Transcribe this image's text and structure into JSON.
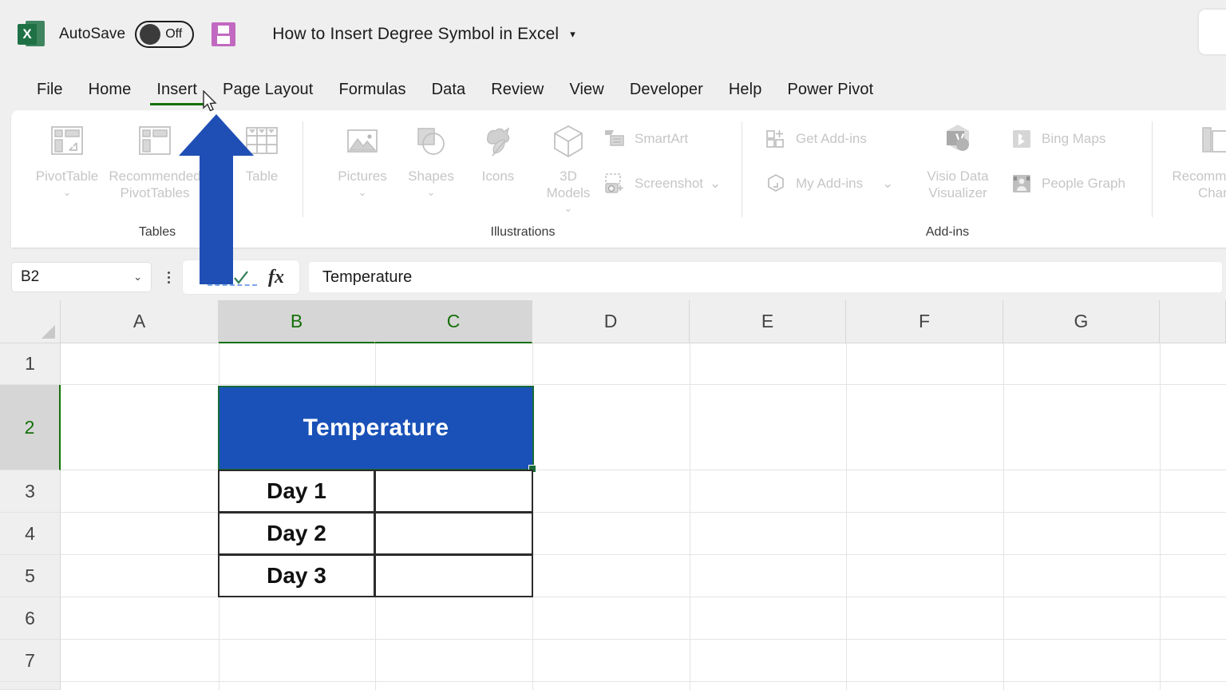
{
  "titlebar": {
    "app_icon": "excel-logo-icon",
    "autosave_label": "AutoSave",
    "autosave_state": "Off",
    "save_icon": "save-floppy-icon",
    "document_title": "How to Insert Degree Symbol in Excel",
    "title_caret": "▾"
  },
  "tabs": [
    {
      "label": "File",
      "active": false
    },
    {
      "label": "Home",
      "active": false
    },
    {
      "label": "Insert",
      "active": true
    },
    {
      "label": "Page Layout",
      "active": false
    },
    {
      "label": "Formulas",
      "active": false
    },
    {
      "label": "Data",
      "active": false
    },
    {
      "label": "Review",
      "active": false
    },
    {
      "label": "View",
      "active": false
    },
    {
      "label": "Developer",
      "active": false
    },
    {
      "label": "Help",
      "active": false
    },
    {
      "label": "Power Pivot",
      "active": false
    }
  ],
  "ribbon": {
    "groups": [
      {
        "name": "Tables",
        "title": "Tables",
        "buttons": [
          {
            "label": "PivotTable",
            "icon": "pivottable-icon",
            "has_caret": true
          },
          {
            "label": "Recommended\nPivotTables",
            "icon": "recommended-pivottables-icon",
            "has_caret": false
          },
          {
            "label": "Table",
            "icon": "table-icon",
            "has_caret": false
          }
        ]
      },
      {
        "name": "Illustrations",
        "title": "Illustrations",
        "buttons": [
          {
            "label": "Pictures",
            "icon": "pictures-icon",
            "has_caret": true
          },
          {
            "label": "Shapes",
            "icon": "shapes-icon",
            "has_caret": true
          },
          {
            "label": "Icons",
            "icon": "icons-icon",
            "has_caret": false
          },
          {
            "label": "3D\nModels",
            "icon": "3d-models-icon",
            "has_caret": true
          }
        ],
        "small_buttons": [
          {
            "label": "SmartArt",
            "icon": "smartart-icon",
            "has_caret": false
          },
          {
            "label": "Screenshot",
            "icon": "screenshot-icon",
            "has_caret": true
          }
        ]
      },
      {
        "name": "Add-ins",
        "title": "Add-ins",
        "small_buttons": [
          {
            "label": "Get Add-ins",
            "icon": "get-addins-icon",
            "has_caret": false
          },
          {
            "label": "My Add-ins",
            "icon": "my-addins-icon",
            "has_caret": true
          },
          {
            "label": "Bing Maps",
            "icon": "bing-maps-icon",
            "has_caret": false
          },
          {
            "label": "People Graph",
            "icon": "people-graph-icon",
            "has_caret": false
          }
        ],
        "buttons": [
          {
            "label": "Visio Data\nVisualizer",
            "icon": "visio-data-visualizer-icon",
            "has_caret": false
          }
        ]
      },
      {
        "name": "Charts",
        "title": "",
        "buttons": [
          {
            "label": "Recommended\nCharts",
            "icon": "recommended-charts-icon",
            "has_caret": false
          }
        ]
      }
    ]
  },
  "formula_bar": {
    "name_box_value": "B2",
    "name_box_caret": "⌄",
    "cancel_icon": "cancel-x-icon",
    "enter_icon": "enter-check-icon",
    "function_icon": "fx-icon",
    "function_label": "fx",
    "formula_value": "Temperature"
  },
  "grid": {
    "columns": [
      "A",
      "B",
      "C",
      "D",
      "E",
      "F",
      "G"
    ],
    "selected_columns": [
      "B",
      "C"
    ],
    "rows": [
      "1",
      "2",
      "3",
      "4",
      "5",
      "6",
      "7"
    ],
    "selected_rows": [
      "2"
    ],
    "active_cell": "B2",
    "merged_title": {
      "range": "B2:C2",
      "text": "Temperature",
      "fill_color": "#1A51B8",
      "font_color": "#FFFFFF"
    },
    "table_rows": [
      {
        "label": "Day 1",
        "value": ""
      },
      {
        "label": "Day 2",
        "value": ""
      },
      {
        "label": "Day 3",
        "value": ""
      }
    ]
  },
  "overlay": {
    "arrow_icon": "up-arrow-annotation",
    "arrow_color": "#1F4FB5",
    "cursor_icon": "mouse-pointer-icon"
  },
  "colors": {
    "accent_green": "#15700A",
    "selection_green": "#176B3A",
    "cell_blue": "#1A51B8",
    "chrome_gray": "#EFEFEF"
  }
}
